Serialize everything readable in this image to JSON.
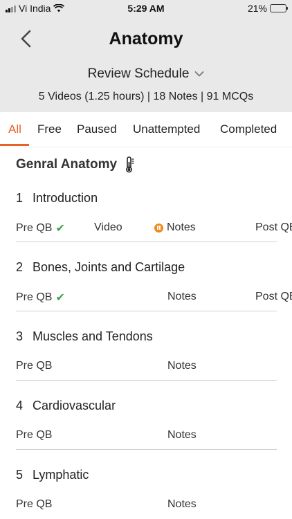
{
  "status_bar": {
    "carrier": "Vi India",
    "time": "5:29 AM",
    "battery": "21%",
    "battery_level": 0.21
  },
  "header": {
    "title": "Anatomy",
    "review_label": "Review Schedule",
    "summary": "5 Videos (1.25 hours) | 18 Notes | 91 MCQs"
  },
  "tabs": [
    {
      "label": "All",
      "active": true
    },
    {
      "label": "Free",
      "active": false
    },
    {
      "label": "Paused",
      "active": false
    },
    {
      "label": "Unattempted",
      "active": false
    },
    {
      "label": "Completed",
      "active": false
    }
  ],
  "section": {
    "title": "Genral Anatomy",
    "icon": "thermometer-icon"
  },
  "topics": [
    {
      "num": "1",
      "title": "Introduction",
      "pre": "Pre QB",
      "pre_done": true,
      "video": "Video",
      "notes": "Notes",
      "notes_paused": true,
      "post": "Post QB"
    },
    {
      "num": "2",
      "title": "Bones, Joints and Cartilage",
      "pre": "Pre QB",
      "pre_done": true,
      "video": "",
      "notes": "Notes",
      "notes_paused": false,
      "post": "Post QB"
    },
    {
      "num": "3",
      "title": "Muscles and Tendons",
      "pre": "Pre QB",
      "pre_done": false,
      "video": "",
      "notes": "Notes",
      "notes_paused": false,
      "post": ""
    },
    {
      "num": "4",
      "title": "Cardiovascular",
      "pre": "Pre QB",
      "pre_done": false,
      "video": "",
      "notes": "Notes",
      "notes_paused": false,
      "post": ""
    },
    {
      "num": "5",
      "title": "Lymphatic",
      "pre": "Pre QB",
      "pre_done": false,
      "video": "",
      "notes": "Notes",
      "notes_paused": false,
      "post": ""
    }
  ],
  "colors": {
    "accent": "#e8632a",
    "check": "#3aa14a",
    "paused": "#ef8a1d",
    "header_bg": "#e9e9e9"
  }
}
